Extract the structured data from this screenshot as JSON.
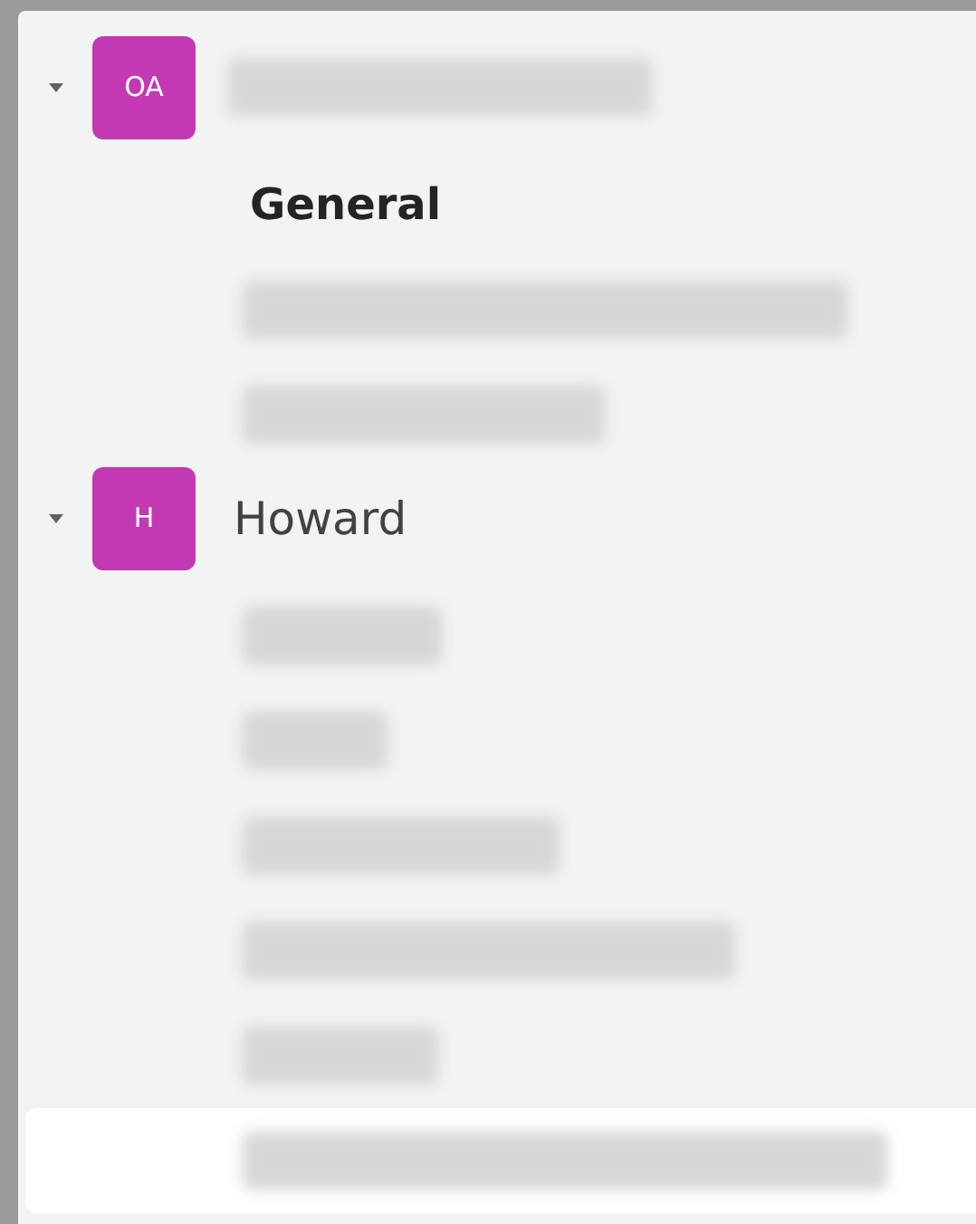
{
  "teams": [
    {
      "initials": "OA",
      "color": "#c239b3",
      "expanded": true,
      "channels": [
        {
          "kind": "text",
          "label": "General",
          "selected": false
        },
        {
          "kind": "blurred",
          "selected": false
        },
        {
          "kind": "blurred",
          "selected": false
        }
      ]
    },
    {
      "initials": "H",
      "name": "Howard",
      "color": "#c239b3",
      "expanded": true,
      "channels": [
        {
          "kind": "blurred",
          "selected": false
        },
        {
          "kind": "blurred",
          "selected": false
        },
        {
          "kind": "blurred",
          "selected": false
        },
        {
          "kind": "blurred",
          "selected": false
        },
        {
          "kind": "blurred",
          "selected": false
        },
        {
          "kind": "blurred",
          "selected": true
        }
      ]
    }
  ]
}
